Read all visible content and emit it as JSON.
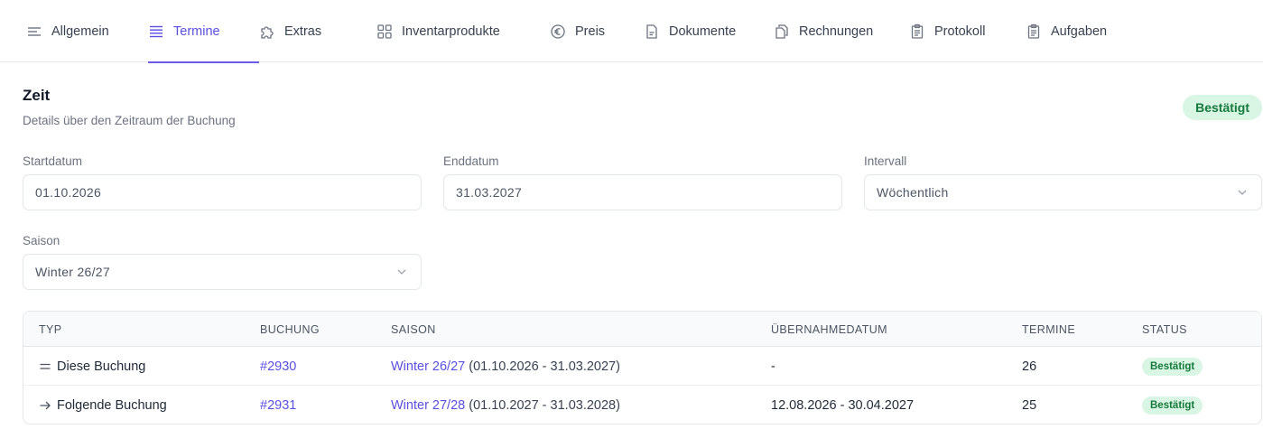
{
  "tabs": [
    {
      "label": "Allgemein",
      "icon": "menu-lines-icon",
      "active": false
    },
    {
      "label": "Termine",
      "icon": "list-icon",
      "active": true
    },
    {
      "label": "Extras",
      "icon": "puzzle-icon",
      "active": false
    },
    {
      "label": "Inventarprodukte",
      "icon": "grid-icon",
      "active": false
    },
    {
      "label": "Preis",
      "icon": "euro-icon",
      "active": false
    },
    {
      "label": "Dokumente",
      "icon": "document-icon",
      "active": false
    },
    {
      "label": "Rechnungen",
      "icon": "copy-icon",
      "active": false
    },
    {
      "label": "Protokoll",
      "icon": "clipboard-icon",
      "active": false
    },
    {
      "label": "Aufgaben",
      "icon": "clipboard-icon",
      "active": false
    }
  ],
  "section": {
    "title": "Zeit",
    "description": "Details über den Zeitraum der Buchung",
    "status": "Bestätigt"
  },
  "form": {
    "start_label": "Startdatum",
    "start_value": "01.10.2026",
    "end_label": "Enddatum",
    "end_value": "31.03.2027",
    "interval_label": "Intervall",
    "interval_value": "Wöchentlich",
    "season_label": "Saison",
    "season_value": "Winter 26/27"
  },
  "table": {
    "headers": [
      "TYP",
      "BUCHUNG",
      "SAISON",
      "ÜBERNAHMEDATUM",
      "TERMINE",
      "STATUS"
    ],
    "rows": [
      {
        "typ_icon": "equals-icon",
        "typ": "Diese Buchung",
        "buchung": "#2930",
        "saison_link": "Winter 26/27",
        "saison_range": " (01.10.2026 - 31.03.2027)",
        "uebernahme": "-",
        "termine": "26",
        "status": "Bestätigt"
      },
      {
        "typ_icon": "arrow-right-icon",
        "typ": "Folgende Buchung",
        "buchung": "#2931",
        "saison_link": "Winter 27/28",
        "saison_range": " (01.10.2027 - 31.03.2028)",
        "uebernahme": "12.08.2026 - 30.04.2027",
        "termine": "25",
        "status": "Bestätigt"
      }
    ]
  },
  "colors": {
    "accent": "#5a4fe0",
    "success_bg": "#d9f5e3",
    "success_text": "#157a3c"
  }
}
